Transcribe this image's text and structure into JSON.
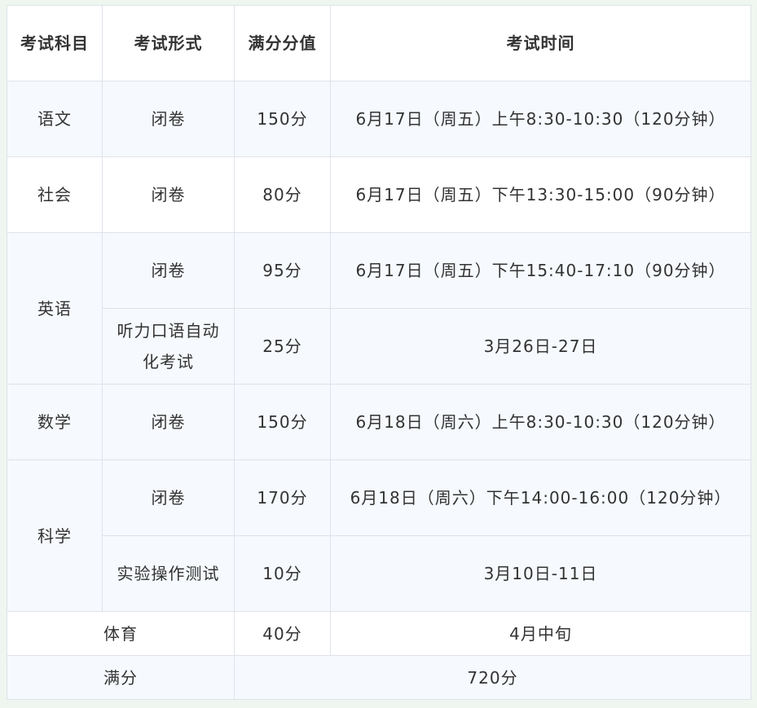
{
  "headers": {
    "subject": "考试科目",
    "form": "考试形式",
    "score": "满分分值",
    "time": "考试时间"
  },
  "rows": {
    "chinese": {
      "subject": "语文",
      "form": "闭卷",
      "score": "150分",
      "time": "6月17日（周五）上午8:30-10:30（120分钟）"
    },
    "society": {
      "subject": "社会",
      "form": "闭卷",
      "score": "80分",
      "time": "6月17日（周五）下午13:30-15:00（90分钟）"
    },
    "english_written": {
      "subject": "英语",
      "form": "闭卷",
      "score": "95分",
      "time": "6月17日（周五）下午15:40-17:10（90分钟）"
    },
    "english_oral": {
      "form": "听力口语自动化考试",
      "score": "25分",
      "time": "3月26日-27日"
    },
    "math": {
      "subject": "数学",
      "form": "闭卷",
      "score": "150分",
      "time": "6月18日（周六）上午8:30-10:30（120分钟）"
    },
    "science_written": {
      "subject": "科学",
      "form": "闭卷",
      "score": "170分",
      "time": "6月18日（周六）下午14:00-16:00（120分钟）"
    },
    "science_lab": {
      "form": "实验操作测试",
      "score": "10分",
      "time": "3月10日-11日"
    },
    "pe": {
      "subject": "体育",
      "score": "40分",
      "time": "4月中旬"
    },
    "total": {
      "label": "满分",
      "score": "720分"
    }
  },
  "colors": {
    "border": "#dfe3ea",
    "alt_row": "#f6f9fd",
    "page_bg": "#eef6ef",
    "text": "#333333"
  }
}
